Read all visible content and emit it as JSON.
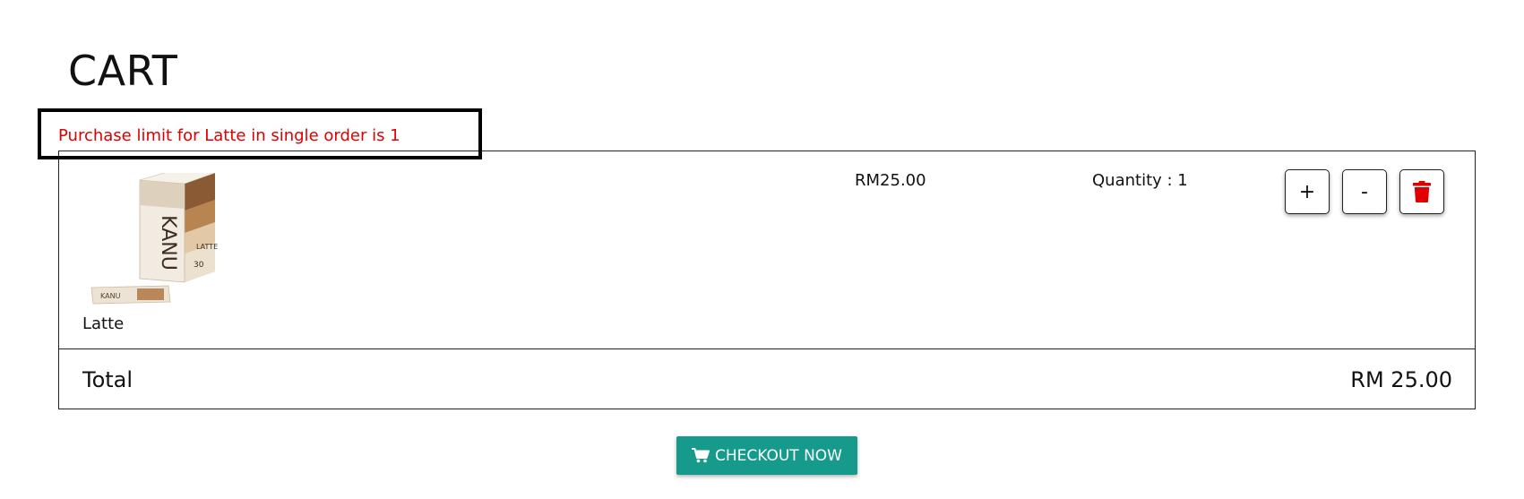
{
  "page": {
    "title": "CART"
  },
  "alert": {
    "message": "Purchase limit for Latte in single order is 1",
    "color": "#e00000"
  },
  "cart": {
    "items": [
      {
        "name": "Latte",
        "price": "RM25.00",
        "quantity_label": "Quantity : 1",
        "image_icon": "kanu-latte-box-image",
        "plus_label": "+",
        "minus_label": "-",
        "delete_icon": "trash-icon",
        "delete_color": "#e00000"
      }
    ],
    "total_label": "Total",
    "total_value": "RM 25.00"
  },
  "checkout": {
    "label": "CHECKOUT NOW",
    "icon": "shopping-cart-icon",
    "color": "#159a8c"
  }
}
